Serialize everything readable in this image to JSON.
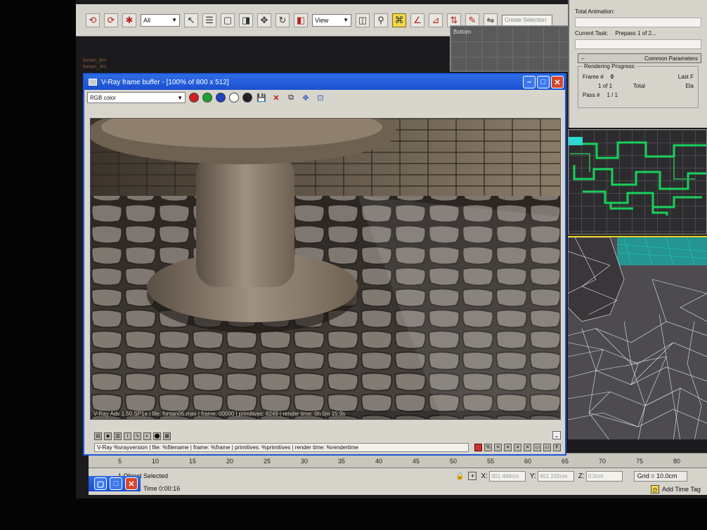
{
  "max_toolbar": {
    "filter_value": "All",
    "coord_value": "View",
    "named_sel_placeholder": "Create Selection"
  },
  "left_scene_text": [
    "fontan_bm",
    "fontan_dm"
  ],
  "viewport_top": {
    "label": "Bottom"
  },
  "render_panel": {
    "total_animation_label": "Total Animation:",
    "current_task_label": "Current Task:",
    "current_task_value": "Prepass 1 of 2...",
    "common_params_label": "Common Parameters",
    "rendering_progress_label": "Rendering Progress:",
    "frame_label": "Frame #",
    "frame_value": "0",
    "frames_done": "1 of 1",
    "total_label": "Total",
    "last_label": "Last F",
    "elapsed_label": "Ela",
    "pass_label": "Pass #",
    "pass_value": "1 / 1"
  },
  "vfb": {
    "title": "V-Ray frame buffer - [100% of 800 x 512]",
    "channel_value": "RGB color",
    "render_info": "V-Ray Adv 1.50.SP1a | file: fontan05.max | frame: 00000 | primitives: 8249 | render time: 0h 0m 15.9s",
    "stamp_value": "V-Ray %vrayversion | file: %filename | frame: %frame | primitives: %primitives | render time: %rendertime",
    "stamp_tools": [
      "%",
      "≡",
      "≡",
      "≡",
      "≡",
      "▭",
      "▭",
      "F"
    ]
  },
  "timeline": {
    "ticks": [
      "5",
      "10",
      "15",
      "20",
      "25",
      "30",
      "35",
      "40",
      "45",
      "50",
      "55",
      "60",
      "65",
      "70",
      "75",
      "80"
    ]
  },
  "statusbar": {
    "selected": "1 Object Selected",
    "x_label": "X:",
    "x_value": "301.466cm",
    "y_label": "Y:",
    "y_value": "401.155cm",
    "z_label": "Z:",
    "z_value": "0.0cm",
    "grid": "Grid = 10.0cm",
    "time": "Time  0:00:16",
    "add_time_tag": "Add Time Tag"
  }
}
